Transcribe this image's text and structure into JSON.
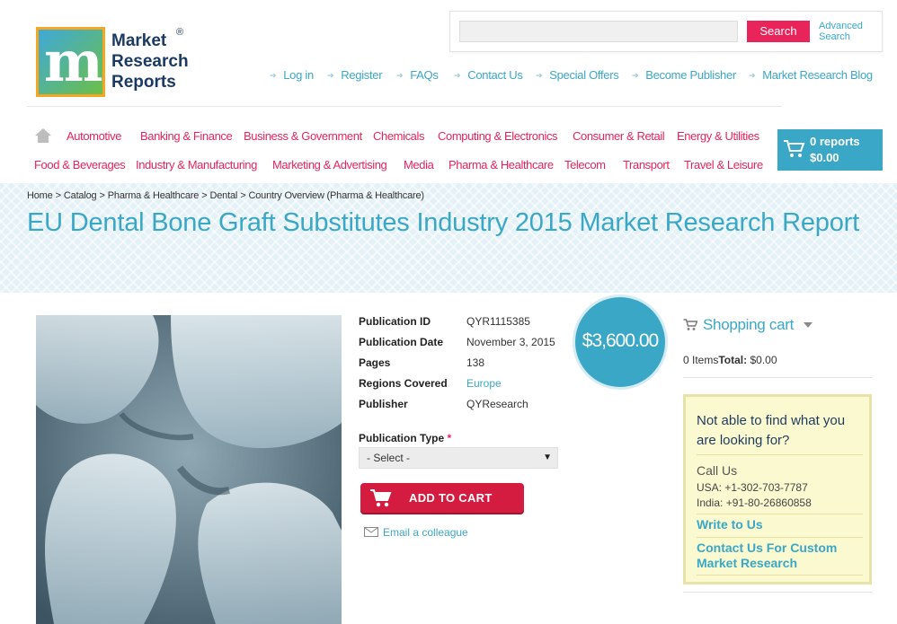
{
  "logo": {
    "line1": "Market",
    "line2": "Research",
    "line3": "Reports",
    "registered": "®"
  },
  "search": {
    "placeholder": "",
    "button_label": "Search",
    "advanced_label": "Advanced Search"
  },
  "top_links": [
    "Log in",
    "Register",
    "FAQs",
    "Contact Us",
    "Special Offers",
    "Become Publisher",
    "Market Research Blog"
  ],
  "categories": {
    "row1": [
      "Automotive",
      "Banking & Finance",
      "Business & Government",
      "Chemicals",
      "Computing & Electronics",
      "Consumer & Retail",
      "Energy & Utilities"
    ],
    "row2": [
      "Food & Beverages",
      "Industry & Manufacturing",
      "Marketing & Advertising",
      "Media",
      "Pharma & Healthcare",
      "Telecom",
      "Transport",
      "Travel & Leisure"
    ]
  },
  "header_cart": {
    "reports": "0 reports",
    "total": "$0.00"
  },
  "breadcrumb": [
    "Home",
    "Catalog",
    "Pharma & Healthcare",
    "Dental",
    "Country Overview (Pharma & Healthcare)"
  ],
  "breadcrumb_sep": ">",
  "title": "EU Dental Bone Graft Substitutes Industry 2015 Market Research Report",
  "details": {
    "publication_id": {
      "label": "Publication ID",
      "value": "QYR1115385"
    },
    "publication_date": {
      "label": "Publication Date",
      "value": "November 3, 2015"
    },
    "pages": {
      "label": "Pages",
      "value": "138"
    },
    "regions": {
      "label": "Regions Covered",
      "value": "Europe"
    },
    "publisher": {
      "label": "Publisher",
      "value": "QYResearch"
    }
  },
  "publication_type": {
    "label": "Publication Type",
    "required_mark": "*",
    "selected": "- Select -"
  },
  "add_to_cart": "ADD TO CART",
  "email_colleague": "Email a colleague",
  "price": "$3,600.00",
  "shopping_cart": {
    "title": "Shopping cart",
    "items_label": "0 Items",
    "total_label": "Total:",
    "total_value": "$0.00"
  },
  "help": {
    "question": "Not able to find what you are looking for?",
    "call_us": "Call Us",
    "phone_usa": "USA: +1-302-703-7787",
    "phone_india": "India: +91-80-26860858",
    "write_to_us": "Write to Us",
    "contact_custom": "Contact Us For Custom Market Research"
  },
  "colors": {
    "accent_blue": "#3aa7c7",
    "accent_red": "#e8245a",
    "help_bg": "#fbf9d0"
  }
}
